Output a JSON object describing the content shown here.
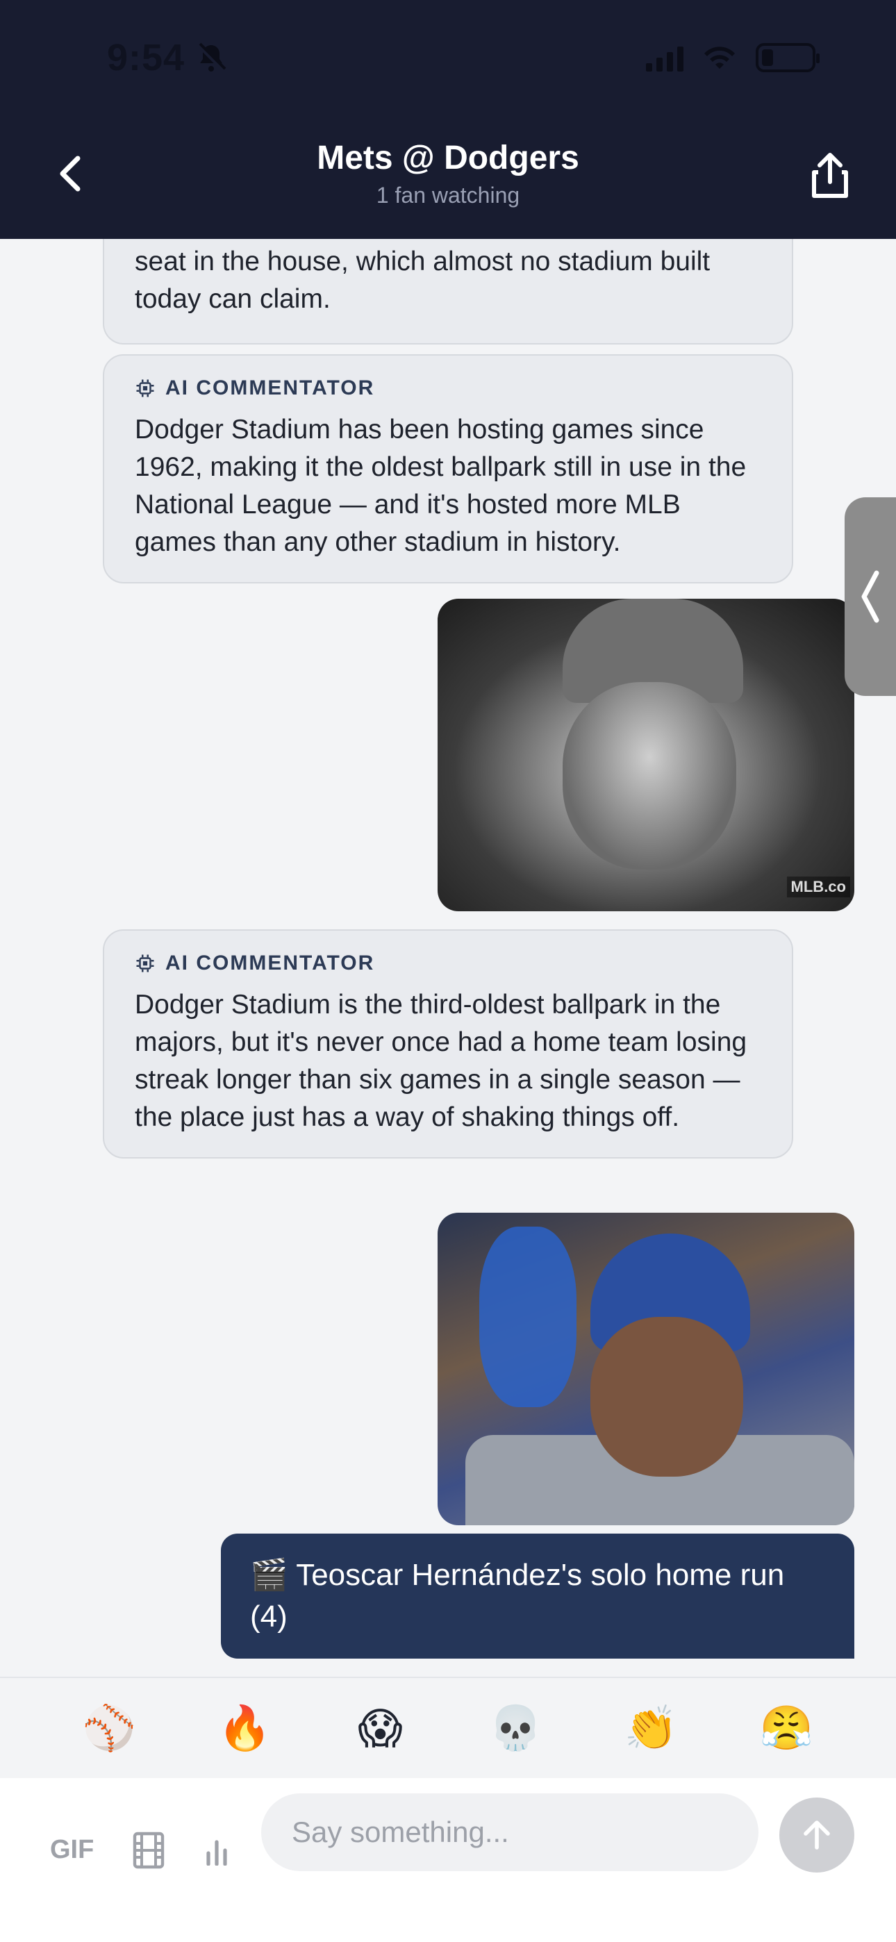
{
  "status_bar": {
    "time": "9:54"
  },
  "header": {
    "title": "Mets @ Dodgers",
    "subtitle": "1 fan watching"
  },
  "messages": {
    "top_card_text": "seat in the house, which almost no stadium built today can claim.",
    "ai_card_1": {
      "label": "AI COMMENTATOR",
      "text": "Dodger Stadium has been hosting games since 1962, making it the oldest ballpark still in use in the National League — and it's hosted more MLB games than any other stadium in history."
    },
    "gif_1": {
      "watermark": "MLB.co"
    },
    "ai_card_2": {
      "label": "AI COMMENTATOR",
      "text": "Dodger Stadium is the third-oldest ballpark in the majors, but it's never once had a home team losing streak longer than six games in a single season — the place just has a way of shaking things off."
    },
    "user_message": "🎬 Teoscar Hernández's solo home run (4)"
  },
  "reactions": [
    "⚾",
    "🔥",
    "😱",
    "💀",
    "👏",
    "😤"
  ],
  "composer": {
    "gif_label": "GIF",
    "placeholder": "Say something..."
  },
  "colors": {
    "header_bg": "#181c30",
    "user_bubble": "#253659",
    "ai_card_bg": "#e9ebef"
  }
}
